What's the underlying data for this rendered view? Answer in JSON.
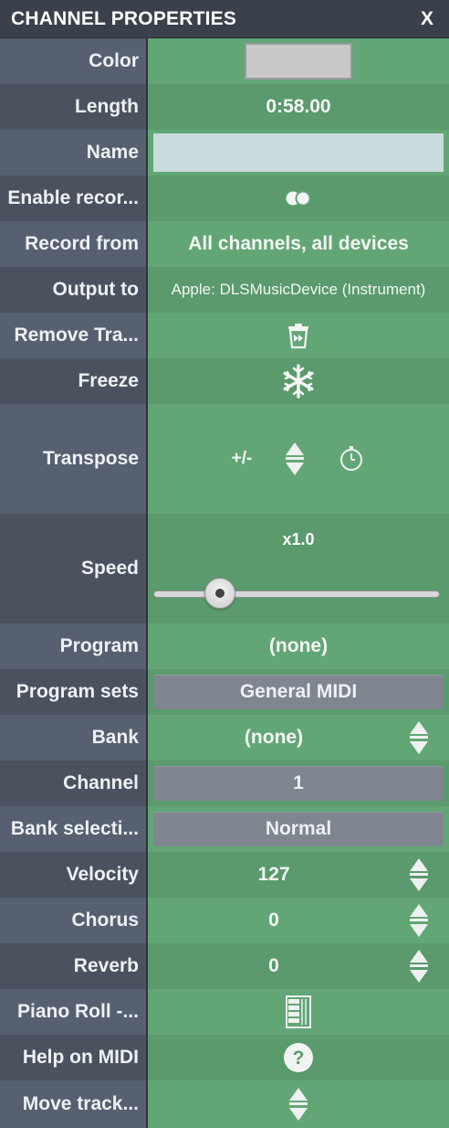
{
  "title": "CHANNEL PROPERTIES",
  "close_label": "X",
  "rows": {
    "color": {
      "label": "Color",
      "swatch": "#c8c8c8"
    },
    "length": {
      "label": "Length",
      "value": "0:58.00"
    },
    "name": {
      "label": "Name",
      "value": ""
    },
    "enable_record": {
      "label": "Enable recor...",
      "icon": "record-toggle-icon"
    },
    "record_from": {
      "label": "Record from",
      "value": "All channels, all devices"
    },
    "output_to": {
      "label": "Output to",
      "value": "Apple: DLSMusicDevice (Instrument)"
    },
    "remove_track": {
      "label": "Remove Tra...",
      "icon": "trash-icon"
    },
    "freeze": {
      "label": "Freeze",
      "icon": "snowflake-icon"
    },
    "transpose": {
      "label": "Transpose",
      "plus_minus": "+/-",
      "icons": [
        "up-down-icon",
        "clock-icon"
      ]
    },
    "speed": {
      "label": "Speed",
      "value": "x1.0",
      "slider_fraction": 0.2
    },
    "program": {
      "label": "Program",
      "value": "(none)"
    },
    "program_sets": {
      "label": "Program sets",
      "value": "General MIDI"
    },
    "bank": {
      "label": "Bank",
      "value": "(none)"
    },
    "channel": {
      "label": "Channel",
      "value": "1"
    },
    "bank_selection": {
      "label": "Bank selecti...",
      "value": "Normal"
    },
    "velocity": {
      "label": "Velocity",
      "value": "127"
    },
    "chorus": {
      "label": "Chorus",
      "value": "0"
    },
    "reverb": {
      "label": "Reverb",
      "value": "0"
    },
    "piano_roll": {
      "label": "Piano Roll -...",
      "icon": "piano-roll-icon"
    },
    "help_midi": {
      "label": "Help on MIDI",
      "icon": "help-icon"
    },
    "move_track": {
      "label": "Move track...",
      "icon": "up-down-icon"
    }
  },
  "colors": {
    "header_bg": "#3a414c",
    "label_bg": "#566070",
    "value_bg": "#63a676",
    "button_bg": "#7f8690"
  }
}
